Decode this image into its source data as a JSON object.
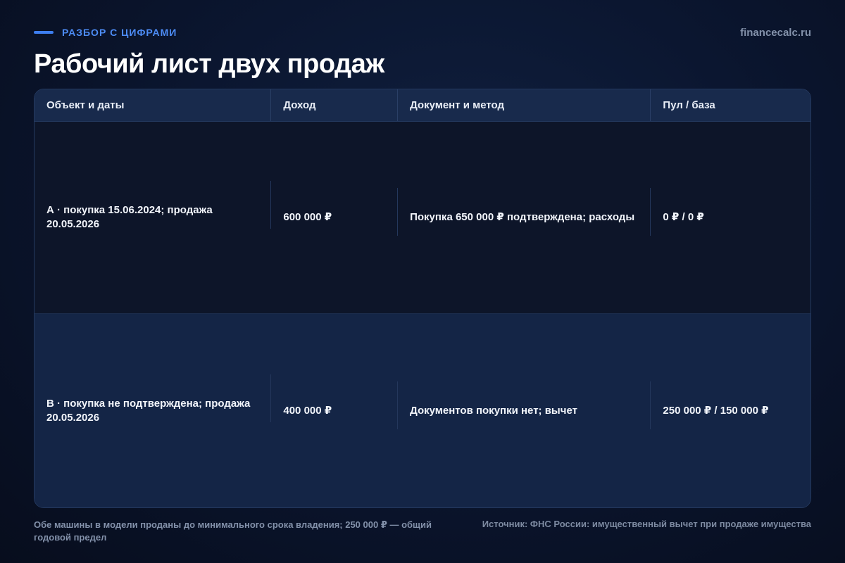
{
  "header": {
    "eyebrow": "РАЗБОР С ЦИФРАМИ",
    "site": "financecalc.ru",
    "title": "Рабочий лист двух продаж"
  },
  "table": {
    "columns": [
      "Объект и даты",
      "Доход",
      "Документ и метод",
      "Пул / база"
    ],
    "rows": [
      {
        "object": "А · покупка 15.06.2024; продажа 20.05.2026",
        "income": "600 000 ₽",
        "document": "Покупка 650 000 ₽ подтверждена; расходы",
        "pool": "0 ₽ / 0 ₽"
      },
      {
        "object": "B · покупка не подтверждена; продажа 20.05.2026",
        "income": "400 000 ₽",
        "document": "Документов покупки нет; вычет",
        "pool": "250 000 ₽ / 150 000 ₽"
      }
    ]
  },
  "footer": {
    "note": "Обе машины в модели проданы до минимального срока владения; 250 000 ₽ — общий годовой предел",
    "source": "Источник: ФНС России: имущественный вычет при продаже имущества"
  },
  "colors": {
    "accent": "#3d7ef0",
    "background": "#0b1630",
    "header_row": "#182a4c"
  }
}
